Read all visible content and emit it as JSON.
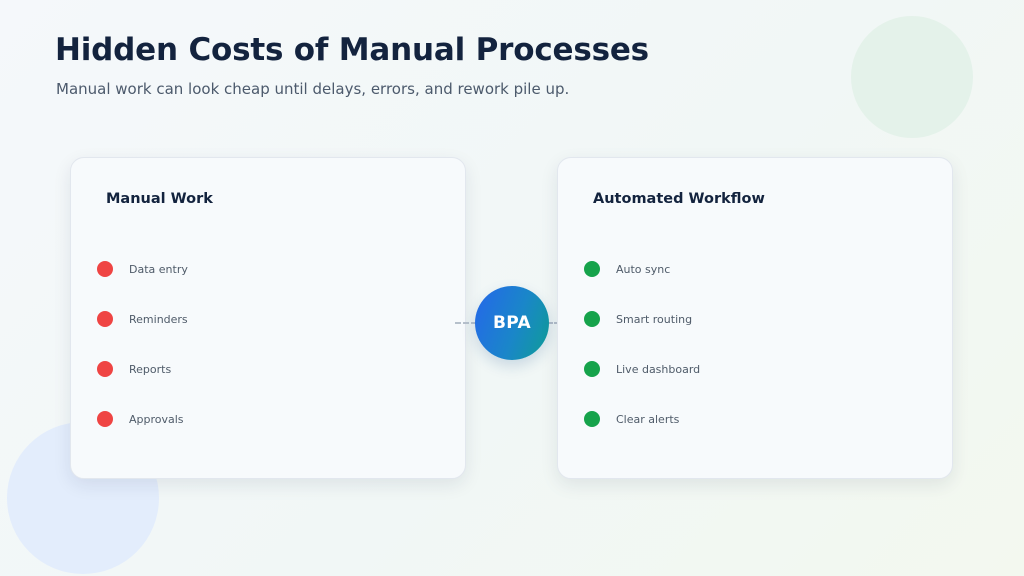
{
  "header": {
    "title": "Hidden Costs of Manual Processes",
    "subtitle": "Manual work can look cheap until delays, errors, and rework pile up."
  },
  "manual_card": {
    "title": "Manual Work",
    "items": [
      {
        "label": "Data entry"
      },
      {
        "label": "Reminders"
      },
      {
        "label": "Reports"
      },
      {
        "label": "Approvals"
      }
    ]
  },
  "center_node": {
    "label": "BPA"
  },
  "automated_card": {
    "title": "Automated Workflow",
    "items": [
      {
        "label": "Auto sync"
      },
      {
        "label": "Smart routing"
      },
      {
        "label": "Live dashboard"
      },
      {
        "label": "Clear alerts"
      }
    ]
  },
  "colors": {
    "manual_dot": "#ef4443",
    "automated_dot": "#16a34b",
    "node_gradient_start": "#2567ea",
    "node_gradient_end": "#0f9d96",
    "title_text": "#13233e"
  }
}
